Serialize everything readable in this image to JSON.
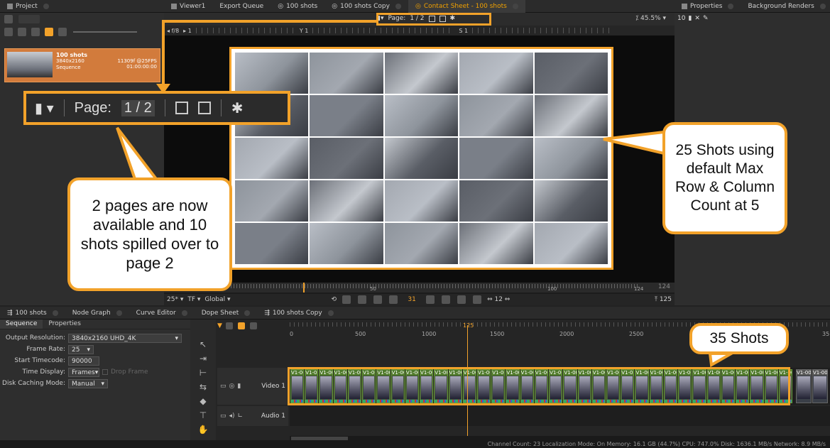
{
  "top_tabs": {
    "project": "Project",
    "viewer1": "Viewer1",
    "export_queue": "Export Queue",
    "shots100": "100 shots",
    "shots100_copy": "100 shots Copy",
    "contact_sheet": "Contact Sheet - 100 shots",
    "properties": "Properties",
    "background_renders": "Background Renders"
  },
  "project_item": {
    "name": "100 shots",
    "resolution": "3840x2160",
    "type": "Sequence",
    "frames_fps": "11309f @25FPS",
    "duration": "01:00:00:00"
  },
  "viewer_toolbar": {
    "page_label": "Page:",
    "page_value": "1 / 2",
    "zoom": "45.5%",
    "fstop": "f/8",
    "channel": "1",
    "y_label": "Y",
    "y_value": "1",
    "s_label": "S",
    "s_value": "1"
  },
  "zoomed_toolbar": {
    "page_label": "Page:",
    "page_value": "1 / 2"
  },
  "callouts": {
    "pages": "2 pages are now available and 10 shots spilled over to page 2",
    "shots25": "25 Shots using default Max Row & Column Count at 5",
    "shots35": "35 Shots"
  },
  "viewer_bottom": {
    "fps": "25*",
    "tf": "TF",
    "global": "Global",
    "current_frame": "31",
    "step": "12",
    "ruler_50": "50",
    "ruler_100": "100",
    "ruler_124": "124",
    "end_frame": "124",
    "out_frame": "125"
  },
  "bottom_tabs": {
    "shots100": "100 shots",
    "node_graph": "Node Graph",
    "curve_editor": "Curve Editor",
    "dope_sheet": "Dope Sheet",
    "shots100_copy": "100 shots Copy"
  },
  "sequence_panel": {
    "tab_sequence": "Sequence",
    "tab_properties": "Properties",
    "output_resolution_label": "Output Resolution:",
    "output_resolution_value": "3840x2160 UHD_4K",
    "frame_rate_label": "Frame Rate:",
    "frame_rate_value": "25",
    "start_timecode_label": "Start Timecode:",
    "start_timecode_value": "90000",
    "time_display_label": "Time Display:",
    "time_display_value": "Frames",
    "drop_frame_label": "Drop Frame",
    "disk_caching_label": "Disk Caching Mode:",
    "disk_caching_value": "Manual"
  },
  "timeline": {
    "ruler": [
      "0",
      "500",
      "1000",
      "1500",
      "2000",
      "2500"
    ],
    "ruler_last": "35",
    "playhead_label": "125",
    "video_track": "Video 1",
    "audio_track": "Audio 1",
    "clip_label": "V1-00"
  },
  "status_bar": "Channel Count: 23  Localization Mode: On  Memory: 16.1 GB (44.7%)  CPU: 747.0%  Disk: 1636.1 MB/s  Network: 8.9 MB/s",
  "colors": {
    "accent": "#f2a22a",
    "clip_green": "#4f7a2a",
    "panel": "#323232"
  }
}
